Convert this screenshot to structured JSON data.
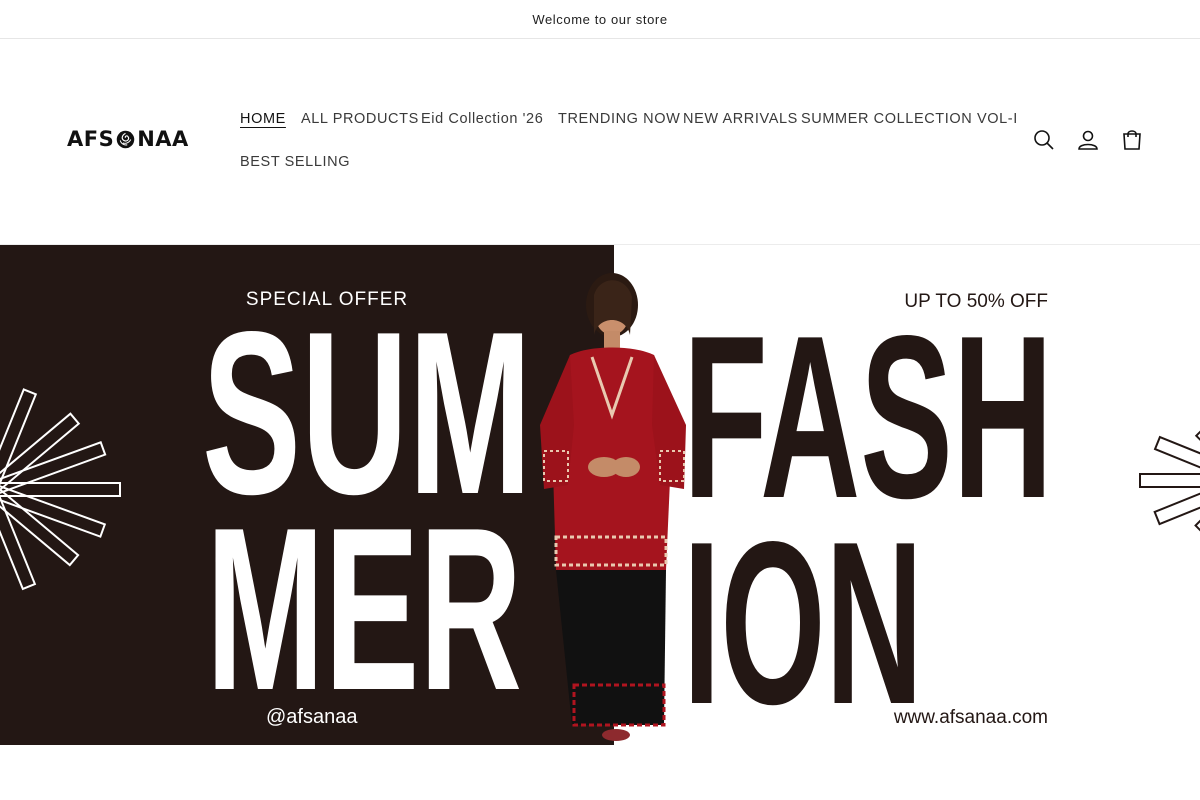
{
  "announcement": {
    "text": "Welcome to our store"
  },
  "header": {
    "logo_text_left": "AFS",
    "logo_text_right": "NAA",
    "nav": [
      {
        "label": "HOME",
        "active": true
      },
      {
        "label": "ALL PRODUCTS",
        "active": false
      },
      {
        "label": "Eid Collection '26",
        "active": false
      },
      {
        "label": "TRENDING NOW",
        "active": false
      },
      {
        "label": "NEW ARRIVALS",
        "active": false
      },
      {
        "label": "SUMMER COLLECTION VOL-I",
        "active": false
      },
      {
        "label": "BEST SELLING",
        "active": false
      }
    ],
    "icons": [
      "search-icon",
      "account-icon",
      "cart-icon"
    ]
  },
  "hero": {
    "special_offer": "SPECIAL OFFER",
    "word_sum": "SUM",
    "word_mer": "MER",
    "word_fash": "FASH",
    "word_ion": "ION",
    "discount": "UP TO 50% OFF",
    "handle": "@afsanaa",
    "website": "www.afsanaa.com",
    "colors": {
      "dark": "#231714",
      "light": "#ffffff",
      "dress_red": "#a5141e",
      "pants": "#111111"
    }
  }
}
